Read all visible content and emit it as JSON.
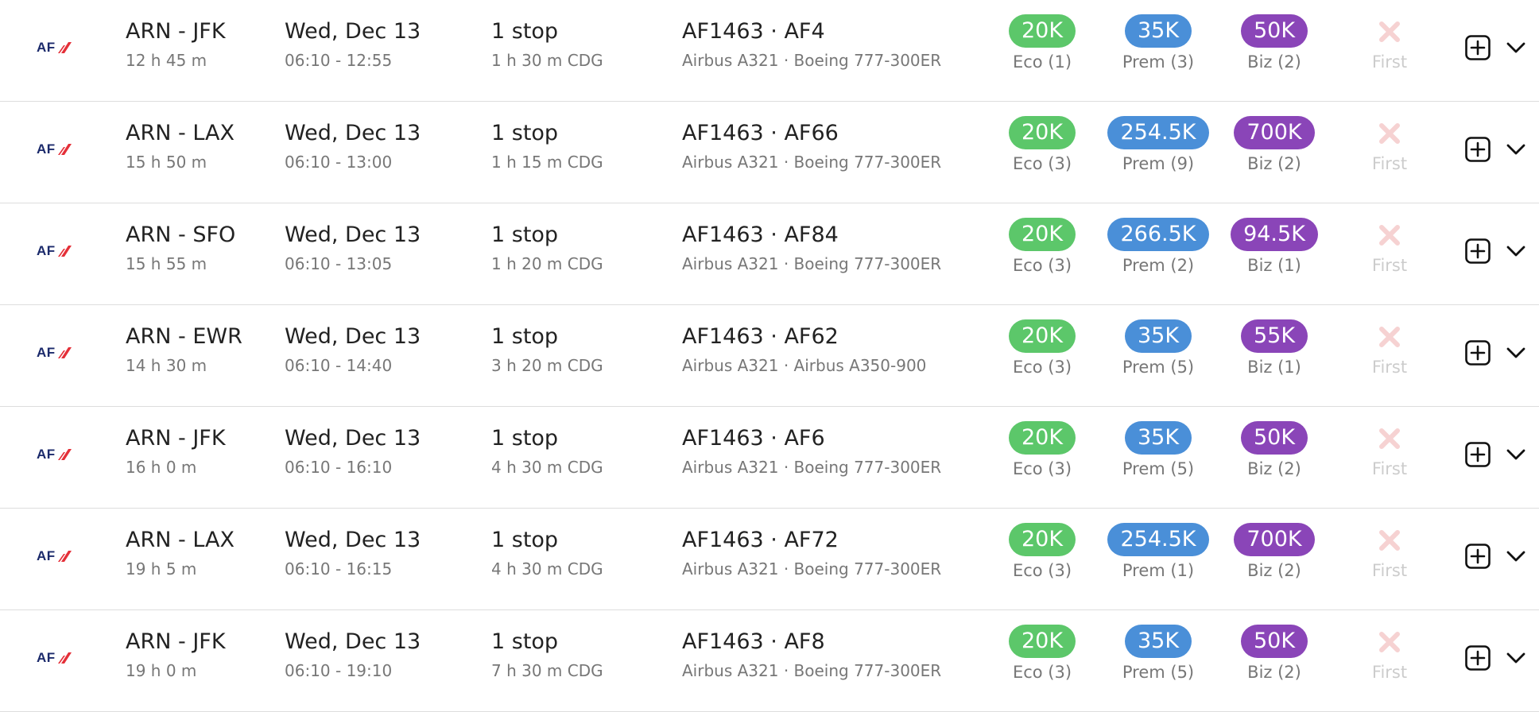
{
  "airline": {
    "logo_text": "AF",
    "accent_color": "#e42f38",
    "brand_color": "#1b2a6b"
  },
  "pill_colors": {
    "eco": "#5cc76a",
    "prem": "#4a8fd8",
    "biz": "#8a45b8",
    "first_unavailable": "#f6d2d2"
  },
  "flights": [
    {
      "route": "ARN - JFK",
      "duration": "12 h 45 m",
      "date": "Wed, Dec 13",
      "times": "06:10 - 12:55",
      "stops": "1 stop",
      "layover": "1 h 30 m  CDG",
      "flight_numbers": "AF1463  ·  AF4",
      "aircraft": "Airbus A321  ·  Boeing 777-300ER",
      "eco": {
        "price": "20K",
        "label": "Eco (1)"
      },
      "prem": {
        "price": "35K",
        "label": "Prem (3)"
      },
      "biz": {
        "price": "50K",
        "label": "Biz (2)"
      },
      "first": {
        "label": "First",
        "available": false,
        "icon": "x-icon"
      }
    },
    {
      "route": "ARN - LAX",
      "duration": "15 h 50 m",
      "date": "Wed, Dec 13",
      "times": "06:10 - 13:00",
      "stops": "1 stop",
      "layover": "1 h 15 m  CDG",
      "flight_numbers": "AF1463  ·  AF66",
      "aircraft": "Airbus A321  ·  Boeing 777-300ER",
      "eco": {
        "price": "20K",
        "label": "Eco (3)"
      },
      "prem": {
        "price": "254.5K",
        "label": "Prem (9)"
      },
      "biz": {
        "price": "700K",
        "label": "Biz (2)"
      },
      "first": {
        "label": "First",
        "available": false,
        "icon": "x-icon"
      }
    },
    {
      "route": "ARN - SFO",
      "duration": "15 h 55 m",
      "date": "Wed, Dec 13",
      "times": "06:10 - 13:05",
      "stops": "1 stop",
      "layover": "1 h 20 m  CDG",
      "flight_numbers": "AF1463  ·  AF84",
      "aircraft": "Airbus A321  ·  Boeing 777-300ER",
      "eco": {
        "price": "20K",
        "label": "Eco (3)"
      },
      "prem": {
        "price": "266.5K",
        "label": "Prem (2)"
      },
      "biz": {
        "price": "94.5K",
        "label": "Biz (1)"
      },
      "first": {
        "label": "First",
        "available": false,
        "icon": "x-icon"
      }
    },
    {
      "route": "ARN - EWR",
      "duration": "14 h 30 m",
      "date": "Wed, Dec 13",
      "times": "06:10 - 14:40",
      "stops": "1 stop",
      "layover": "3 h 20 m  CDG",
      "flight_numbers": "AF1463  ·  AF62",
      "aircraft": "Airbus A321  ·  Airbus A350-900",
      "eco": {
        "price": "20K",
        "label": "Eco (3)"
      },
      "prem": {
        "price": "35K",
        "label": "Prem (5)"
      },
      "biz": {
        "price": "55K",
        "label": "Biz (1)"
      },
      "first": {
        "label": "First",
        "available": false,
        "icon": "x-icon"
      }
    },
    {
      "route": "ARN - JFK",
      "duration": "16 h 0 m",
      "date": "Wed, Dec 13",
      "times": "06:10 - 16:10",
      "stops": "1 stop",
      "layover": "4 h 30 m  CDG",
      "flight_numbers": "AF1463  ·  AF6",
      "aircraft": "Airbus A321  ·  Boeing 777-300ER",
      "eco": {
        "price": "20K",
        "label": "Eco (3)"
      },
      "prem": {
        "price": "35K",
        "label": "Prem (5)"
      },
      "biz": {
        "price": "50K",
        "label": "Biz (2)"
      },
      "first": {
        "label": "First",
        "available": false,
        "icon": "x-icon"
      }
    },
    {
      "route": "ARN - LAX",
      "duration": "19 h 5 m",
      "date": "Wed, Dec 13",
      "times": "06:10 - 16:15",
      "stops": "1 stop",
      "layover": "4 h 30 m  CDG",
      "flight_numbers": "AF1463  ·  AF72",
      "aircraft": "Airbus A321  ·  Boeing 777-300ER",
      "eco": {
        "price": "20K",
        "label": "Eco (3)"
      },
      "prem": {
        "price": "254.5K",
        "label": "Prem (1)"
      },
      "biz": {
        "price": "700K",
        "label": "Biz (2)"
      },
      "first": {
        "label": "First",
        "available": false,
        "icon": "x-icon"
      }
    },
    {
      "route": "ARN - JFK",
      "duration": "19 h 0 m",
      "date": "Wed, Dec 13",
      "times": "06:10 - 19:10",
      "stops": "1 stop",
      "layover": "7 h 30 m  CDG",
      "flight_numbers": "AF1463  ·  AF8",
      "aircraft": "Airbus A321  ·  Boeing 777-300ER",
      "eco": {
        "price": "20K",
        "label": "Eco (3)"
      },
      "prem": {
        "price": "35K",
        "label": "Prem (5)"
      },
      "biz": {
        "price": "50K",
        "label": "Biz (2)"
      },
      "first": {
        "label": "First",
        "available": false,
        "icon": "x-icon"
      }
    }
  ]
}
